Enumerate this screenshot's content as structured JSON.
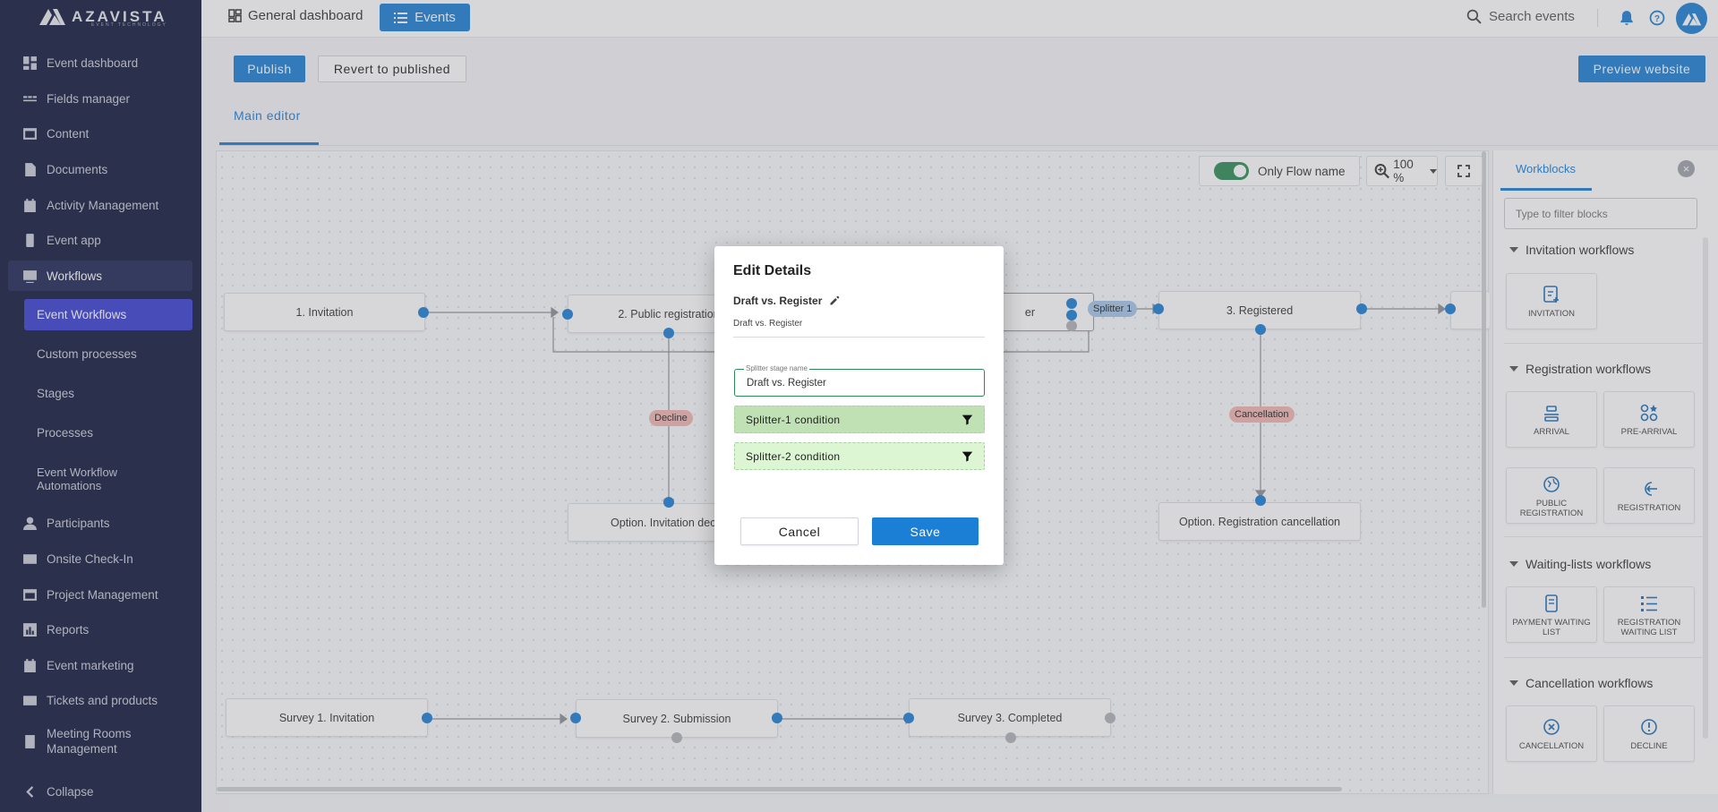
{
  "app": {
    "brand": "AZAVISTA",
    "brand_sub": "EVENT TECHNOLOGY",
    "accent": "#1c7fd6",
    "sidebar_bg": "#11183d"
  },
  "sidebar": {
    "items": [
      {
        "label": "Event dashboard",
        "icon": "dashboard-icon"
      },
      {
        "label": "Fields manager",
        "icon": "fields-icon"
      },
      {
        "label": "Content",
        "icon": "content-icon"
      },
      {
        "label": "Documents",
        "icon": "document-icon"
      },
      {
        "label": "Activity Management",
        "icon": "calendar-icon"
      },
      {
        "label": "Event app",
        "icon": "phone-icon"
      },
      {
        "label": "Workflows",
        "icon": "workflow-icon"
      },
      {
        "label": "Participants",
        "icon": "person-icon"
      },
      {
        "label": "Onsite Check-In",
        "icon": "mail-icon"
      },
      {
        "label": "Project Management",
        "icon": "project-icon"
      },
      {
        "label": "Reports",
        "icon": "reports-icon"
      },
      {
        "label": "Event marketing",
        "icon": "marketing-icon"
      },
      {
        "label": "Tickets and products",
        "icon": "ticket-icon"
      },
      {
        "label": "Meeting Rooms",
        "label2": "Management",
        "icon": "meeting-room-icon"
      }
    ],
    "sub_items": [
      "Event Workflows",
      "Custom processes",
      "Stages",
      "Processes",
      "Event Workflow",
      "Automations"
    ],
    "collapse": "Collapse"
  },
  "topbar": {
    "general": "General dashboard",
    "events": "Events",
    "search": "Search events"
  },
  "toolbar": {
    "publish": "Publish",
    "revert": "Revert to published",
    "preview": "Preview website"
  },
  "tabs": {
    "main": "Main editor"
  },
  "canvas": {
    "only_flow_name": "Only Flow name",
    "zoom": "100 %",
    "nodes": {
      "n1": "1. Invitation",
      "n2": "2. Public registration",
      "n2b": "er",
      "n3": "3. Registered",
      "opt1": "Option. Invitation declin",
      "opt2": "Option. Registration cancellation",
      "s1": "Survey 1. Invitation",
      "s2": "Survey 2. Submission",
      "s3": "Survey 3. Completed"
    },
    "labels": {
      "decline": "Decline",
      "cancellation": "Cancellation",
      "splitter": "Splitter 1"
    }
  },
  "panel": {
    "tab": "Workblocks",
    "filter_placeholder": "Type to filter blocks",
    "sections": [
      {
        "title": "Invitation workflows",
        "blocks": [
          {
            "label": "INVITATION"
          }
        ]
      },
      {
        "title": "Registration workflows",
        "blocks": [
          {
            "label": "ARRIVAL"
          },
          {
            "label": "PRE-ARRIVAL"
          },
          {
            "label": "PUBLIC REGISTRATION"
          },
          {
            "label": "REGISTRATION"
          }
        ]
      },
      {
        "title": "Waiting-lists workflows",
        "blocks": [
          {
            "label": "PAYMENT WAITING LIST"
          },
          {
            "label": "REGISTRATION WAITING LIST"
          }
        ]
      },
      {
        "title": "Cancellation workflows",
        "blocks": [
          {
            "label": "CANCELLATION"
          },
          {
            "label": "DECLINE"
          }
        ]
      }
    ]
  },
  "modal": {
    "title": "Edit Details",
    "name": "Draft vs. Register",
    "sub": "Draft vs. Register",
    "field_label": "Splitter stage name",
    "field_value": "Draft vs. Register",
    "cond1": "Splitter-1 condition",
    "cond2": "Splitter-2 condition",
    "cancel": "Cancel",
    "save": "Save"
  }
}
